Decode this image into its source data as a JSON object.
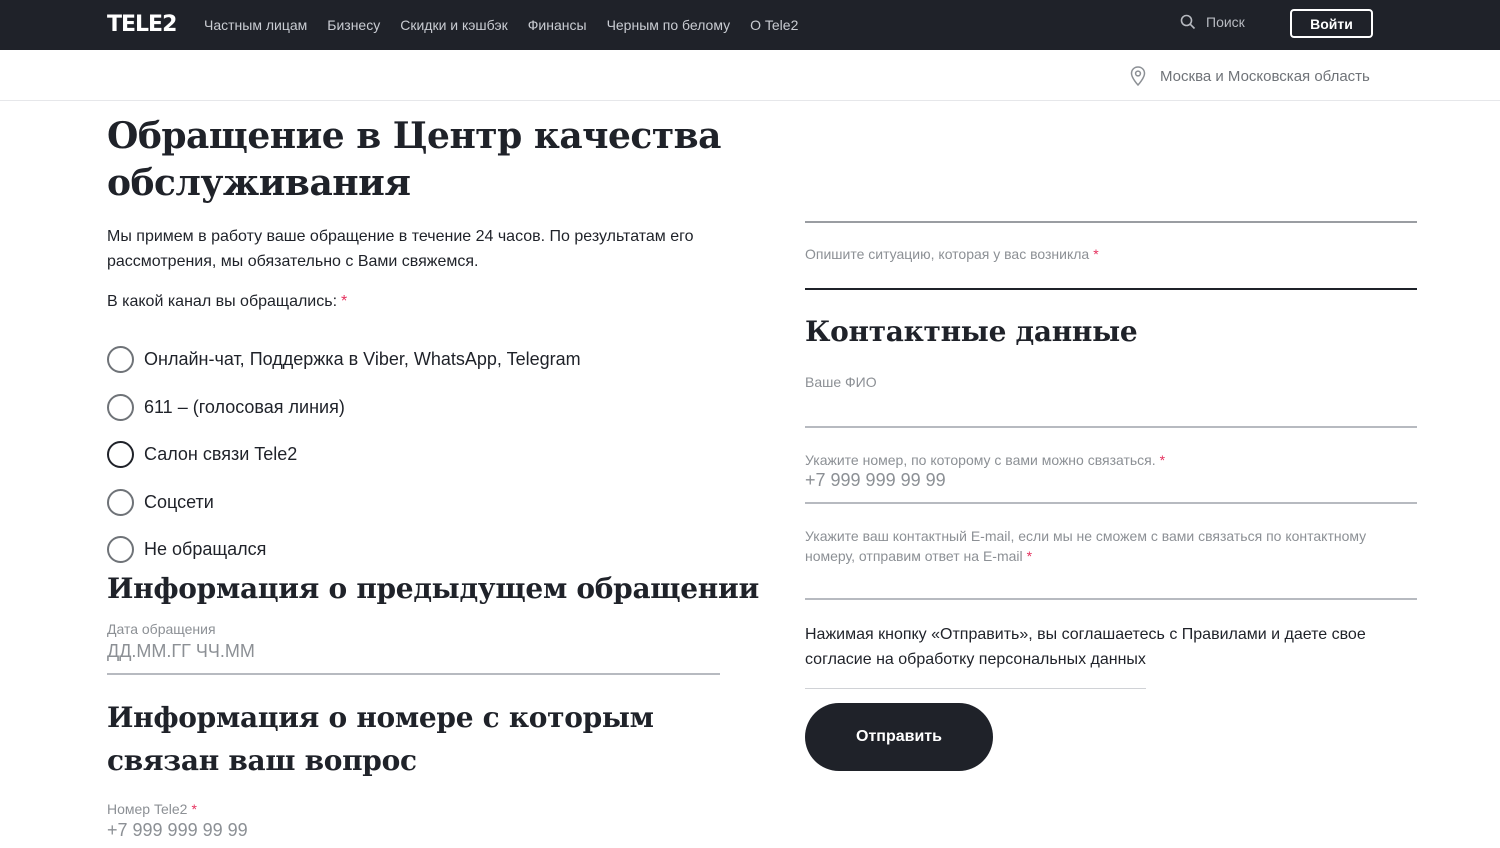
{
  "header": {
    "logo": "TELE2",
    "nav": [
      "Частным лицам",
      "Бизнесу",
      "Скидки и кэшбэк",
      "Финансы",
      "Черным по белому",
      "О Tele2"
    ],
    "search_label": "Поиск",
    "login_label": "Войти"
  },
  "region": "Москва и Московская область",
  "title": "Обращение в Центр качества обслуживания",
  "intro": "Мы примем в работу ваше обращение в течение 24 часов. По результатам его рассмотрения, мы обязательно с Вами свяжемся.",
  "channel": {
    "label": "В какой канал вы обращались:",
    "required": "*",
    "options": [
      "Онлайн-чат, Поддержка в Viber, WhatsApp, Telegram",
      "611 – (голосовая линия)",
      "Салон связи Tele2",
      "Соцсети",
      "Не обращался"
    ]
  },
  "previous": {
    "heading": "Информация о предыдущем  обращении",
    "date_label": "Дата обращения",
    "date_placeholder": "ДД.ММ.ГГ ЧЧ.ММ"
  },
  "number_info": {
    "heading": "Информация о номере с которым связан ваш вопрос",
    "number_label": "Номер Tele2",
    "required": "*",
    "number_placeholder": "+7 999 999 99 99"
  },
  "situation": {
    "label": "Опишите ситуацию, которая у вас возникла",
    "required": "*"
  },
  "contacts": {
    "heading": "Контактные данные",
    "fio_label": "Ваше ФИО",
    "phone_label": "Укажите номер, по которому с вами можно связаться.",
    "phone_required": "*",
    "phone_placeholder": "+7 999 999 99 99",
    "email_label": "Укажите ваш контактный E-mail, если мы не сможем с вами связаться по контактному номеру, отправим ответ на E-mail",
    "email_required": "*"
  },
  "agreement": "Нажимая кнопку «Отправить», вы соглашаетесь с Правилами и даете свое согласие на обработку персональных данных",
  "submit_label": "Отправить"
}
